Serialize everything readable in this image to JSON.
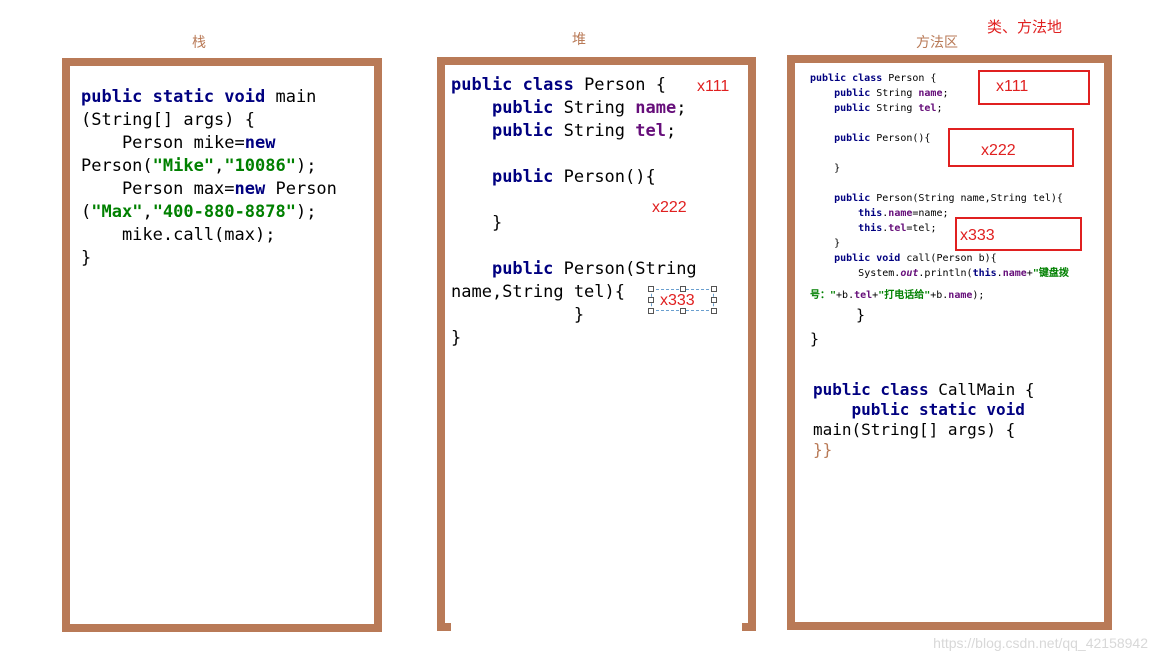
{
  "labels": {
    "stack": "栈",
    "heap": "堆",
    "method_area": "方法区",
    "class_method_area": "类、方法地"
  },
  "stack_code": {
    "l1_kw": "public static void",
    "l1_rest": " main",
    "l2": "(String[] args) {",
    "l3_pre": "    Person mike=",
    "l3_kw": "new",
    "l4_pre": "Person(",
    "l4_s1": "\"Mike\"",
    "l4_comma": ",",
    "l4_s2": "\"10086\"",
    "l4_end": ");",
    "l5_pre": "    Person max=",
    "l5_kw": "new",
    "l5_rest": " Person",
    "l6_pre": "(",
    "l6_s1": "\"Max\"",
    "l6_comma": ",",
    "l6_s2": "\"400-880-8878\"",
    "l6_end": ");",
    "l7": "    mike.call(max);",
    "l8": "}"
  },
  "heap_code": {
    "l1_kw": "public class",
    "l1_rest": " Person {",
    "l2_kw": "public",
    "l2_mid": " String ",
    "l2_fld": "name",
    "l2_end": ";",
    "l3_kw": "public",
    "l3_mid": " String ",
    "l3_fld": "tel",
    "l3_end": ";",
    "l4_kw": "public",
    "l4_rest": " Person(){",
    "l5": "    }",
    "l6_kw": "public",
    "l6_rest": " Person(String",
    "l7": "name,String tel){",
    "l8": "            }",
    "l9": "}"
  },
  "method_code": {
    "l1_kw": "public class",
    "l1_rest": " Person {",
    "l2_kw": "public",
    "l2_mid": " String ",
    "l2_fld": "name",
    "l2_end": ";",
    "l3_kw": "public",
    "l3_mid": " String ",
    "l3_fld": "tel",
    "l3_end": ";",
    "l4_kw": "public",
    "l4_rest": " Person(){",
    "l5": "    }",
    "l6_kw": "public",
    "l6_rest": " Person(String name,String tel){",
    "l7_kw": "this",
    "l7_dot": ".",
    "l7_fld": "name",
    "l7_rest": "=name;",
    "l8_kw": "this",
    "l8_dot": ".",
    "l8_fld": "tel",
    "l8_rest": "=tel;",
    "l9": "    }",
    "l10_kw": "public void",
    "l10_rest": " call(Person b){",
    "l11_pre": "System.",
    "l11_it": "out",
    "l11_mid": ".println(",
    "l11_kw": "this",
    "l11_dot": ".",
    "l11_fld": "name",
    "l11_plus": "+",
    "l11_str": "\"键盘拨",
    "l12_str1": "号：\"",
    "l12_mid": "+b.",
    "l12_fld": "tel",
    "l12_plus": "+",
    "l12_str2": "\"打电话给\"",
    "l12_mid2": "+b.",
    "l12_fld2": "name",
    "l12_end": ");",
    "l13": "}",
    "l14": "}",
    "cm1_kw": "public class",
    "cm1_rest": " CallMain {",
    "cm2_kw": "public static void",
    "cm3": "main(String[] args) {",
    "cm4": "}}"
  },
  "tags": {
    "heap_x111": "x111",
    "heap_x222": "x222",
    "heap_x333": "x333",
    "method_x111": "x111",
    "method_x222": "x222",
    "method_x333": "x333"
  },
  "watermark": "https://blog.csdn.net/qq_42158942",
  "colors": {
    "border": "#b97a57",
    "keyword": "#000080",
    "string": "#008000",
    "field": "#660e7a",
    "tag": "#e02020"
  }
}
